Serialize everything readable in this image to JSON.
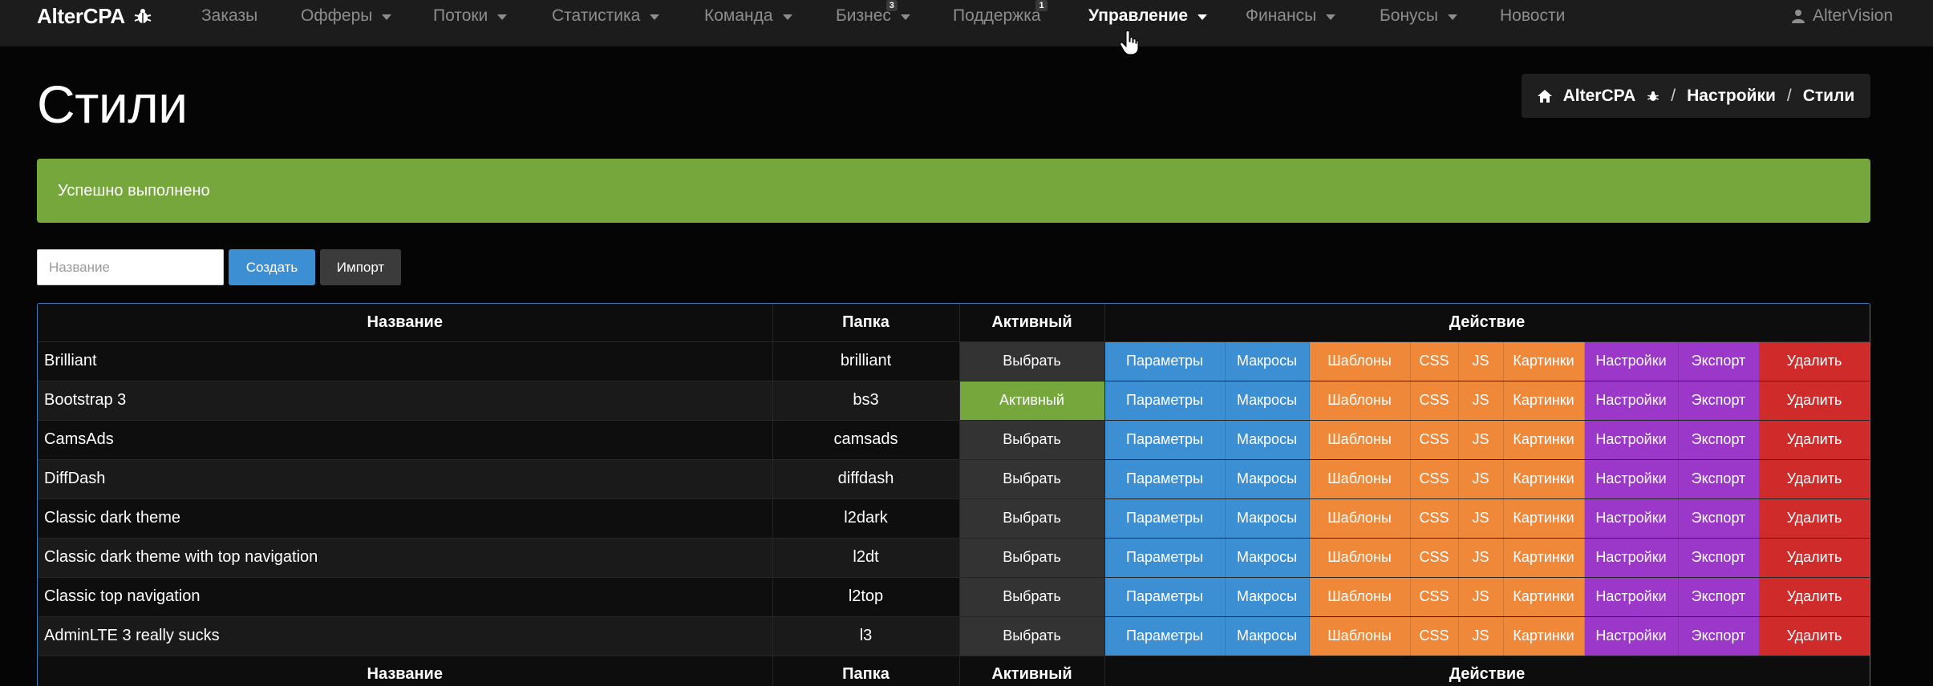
{
  "navbar": {
    "brand": "AlterCPA",
    "items": [
      {
        "label": "Заказы",
        "caret": false,
        "active": false,
        "badge": ""
      },
      {
        "label": "Офферы",
        "caret": true,
        "active": false,
        "badge": ""
      },
      {
        "label": "Потоки",
        "caret": true,
        "active": false,
        "badge": ""
      },
      {
        "label": "Статистика",
        "caret": true,
        "active": false,
        "badge": ""
      },
      {
        "label": "Команда",
        "caret": true,
        "active": false,
        "badge": ""
      },
      {
        "label": "Бизнес",
        "caret": true,
        "active": false,
        "badge": "3"
      },
      {
        "label": "Поддержка",
        "caret": false,
        "active": false,
        "badge": "1"
      },
      {
        "label": "Управление",
        "caret": true,
        "active": true,
        "badge": ""
      },
      {
        "label": "Финансы",
        "caret": true,
        "active": false,
        "badge": ""
      },
      {
        "label": "Бонусы",
        "caret": true,
        "active": false,
        "badge": ""
      },
      {
        "label": "Новости",
        "caret": false,
        "active": false,
        "badge": ""
      }
    ],
    "user": "AlterVision"
  },
  "page": {
    "title": "Стили",
    "breadcrumb": [
      "AlterCPA",
      "Настройки",
      "Стили"
    ],
    "breadcrumb_sep": "/"
  },
  "alert": {
    "text": "Успешно выполнено"
  },
  "form": {
    "name_placeholder": "Название",
    "create_label": "Создать",
    "import_label": "Импорт"
  },
  "table": {
    "headers": {
      "name": "Название",
      "folder": "Папка",
      "active": "Активный",
      "action": "Действие"
    },
    "select_label": "Выбрать",
    "active_label": "Активный",
    "actions": [
      {
        "label": "Параметры",
        "color": "blue"
      },
      {
        "label": "Макросы",
        "color": "blue"
      },
      {
        "label": "Шаблоны",
        "color": "orange"
      },
      {
        "label": "CSS",
        "color": "orange"
      },
      {
        "label": "JS",
        "color": "orange"
      },
      {
        "label": "Картинки",
        "color": "orange"
      },
      {
        "label": "Настройки",
        "color": "purple"
      },
      {
        "label": "Экспорт",
        "color": "purple"
      },
      {
        "label": "Удалить",
        "color": "red"
      }
    ],
    "rows": [
      {
        "name": "Brilliant",
        "folder": "brilliant",
        "active": false
      },
      {
        "name": "Bootstrap 3",
        "folder": "bs3",
        "active": true
      },
      {
        "name": "CamsAds",
        "folder": "camsads",
        "active": false
      },
      {
        "name": "DiffDash",
        "folder": "diffdash",
        "active": false
      },
      {
        "name": "Classic dark theme",
        "folder": "l2dark",
        "active": false
      },
      {
        "name": "Classic dark theme with top navigation",
        "folder": "l2dt",
        "active": false
      },
      {
        "name": "Classic top navigation",
        "folder": "l2top",
        "active": false
      },
      {
        "name": "AdminLTE 3 really sucks",
        "folder": "l3",
        "active": false
      }
    ]
  },
  "colors": {
    "blue": "#3d8fd4",
    "orange": "#f0883a",
    "purple": "#9b37c9",
    "red": "#cf2b2b",
    "green": "#76a73c",
    "navbar_bg": "#1c1c1c"
  }
}
